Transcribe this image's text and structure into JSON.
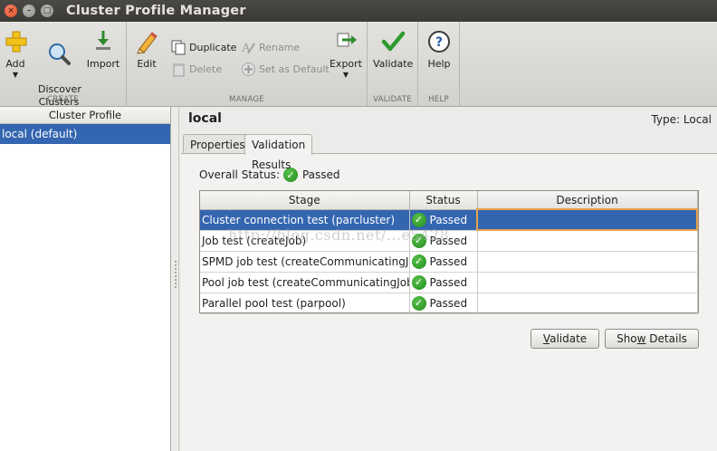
{
  "window": {
    "title": "Cluster Profile Manager",
    "close_glyph": "×",
    "min_glyph": "–",
    "max_glyph": "□"
  },
  "toolbar": {
    "groups": {
      "create": "CREATE",
      "manage": "MANAGE",
      "validate": "VALIDATE",
      "help": "HELP"
    },
    "add": "Add",
    "discover": "Discover\nClusters",
    "import": "Import",
    "edit": "Edit",
    "duplicate": "Duplicate",
    "delete": "Delete",
    "rename": "Rename",
    "set_default": "Set as Default",
    "export": "Export",
    "validate": "Validate",
    "help": "Help",
    "dropdown_glyph": "▼"
  },
  "profiles": {
    "header": "Cluster Profile",
    "items": [
      {
        "label": "local (default)",
        "selected": true
      }
    ]
  },
  "details": {
    "profile_name": "local",
    "type_label": "Type: Local",
    "tabs": [
      "Properties",
      "Validation Results"
    ],
    "active_tab": 1,
    "overall_label": "Overall Status:",
    "overall_value": "Passed",
    "columns": [
      "Stage",
      "Status",
      "Description"
    ],
    "rows": [
      {
        "stage": "Cluster connection test (parcluster)",
        "status": "Passed",
        "description": "",
        "selected": true
      },
      {
        "stage": "Job test (createJob)",
        "status": "Passed",
        "description": ""
      },
      {
        "stage": "SPMD job test (createCommunicatingJob)",
        "status": "Passed",
        "description": ""
      },
      {
        "stage": "Pool job test (createCommunicatingJob)",
        "status": "Passed",
        "description": ""
      },
      {
        "stage": "Parallel pool test (parpool)",
        "status": "Passed",
        "description": ""
      }
    ],
    "validate_button": {
      "key": "V",
      "rest": "alidate"
    },
    "show_details_button": {
      "pre": "Sho",
      "key": "w",
      "rest": " Details"
    }
  },
  "watermark": "http://blog.csdn.net/...e5428",
  "colors": {
    "selection": "#3466b0",
    "passed": "#2a9a24",
    "focus_border": "#e7a34a"
  }
}
